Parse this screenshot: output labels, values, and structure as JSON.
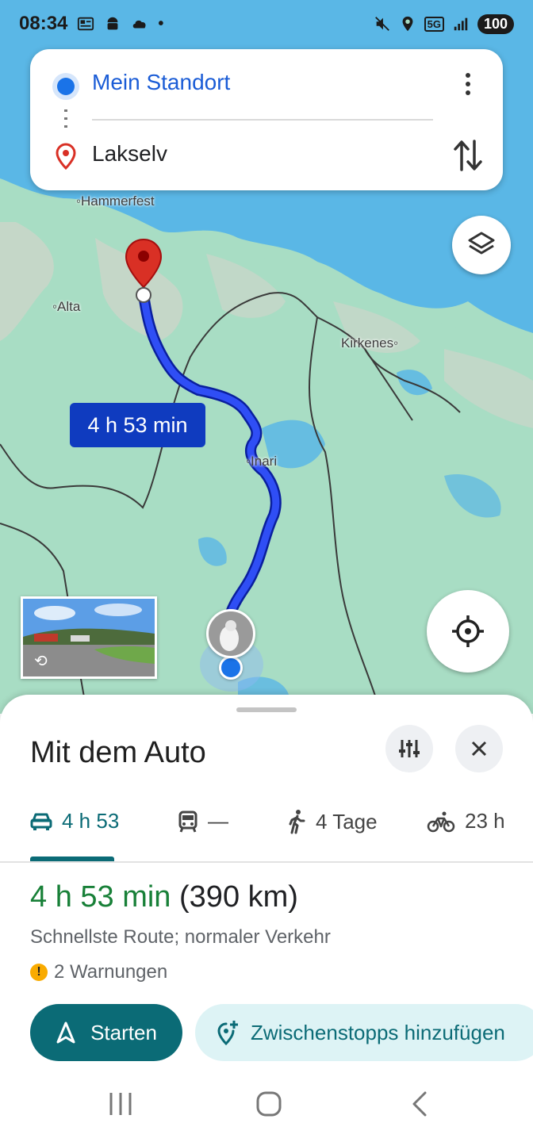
{
  "status_bar": {
    "time": "08:34",
    "battery": "100",
    "icons": [
      "news-icon",
      "android-icon",
      "cloud-icon",
      "dot-icon",
      "mute-icon",
      "location-icon",
      "5g-icon",
      "signal-icon"
    ]
  },
  "search": {
    "origin": "Mein Standort",
    "destination": "Lakselv"
  },
  "map": {
    "labels": {
      "hammerfest": "Hammerfest",
      "alta": "Alta",
      "kirkenes": "Kirkenes",
      "inari": "Inari"
    },
    "route_time_bubble": "4 h 53 min",
    "colors": {
      "route": "#1a2fd6",
      "land": "#a8ddc4",
      "water": "#5ab7e6",
      "destination_pin": "#d93025"
    }
  },
  "sheet": {
    "title": "Mit dem Auto",
    "modes": [
      {
        "icon": "car-icon",
        "label": "4 h 53",
        "active": true
      },
      {
        "icon": "train-icon",
        "label": "—",
        "active": false
      },
      {
        "icon": "walk-icon",
        "label": "4 Tage",
        "active": false
      },
      {
        "icon": "bike-icon",
        "label": "23 h",
        "active": false
      }
    ],
    "route": {
      "duration": "4 h 53 min",
      "distance": "(390 km)",
      "description": "Schnellste Route; normaler Verkehr",
      "warnings": "2 Warnungen"
    },
    "start_label": "Starten",
    "add_stops_label": "Zwischenstopps hinzufügen",
    "accent_color": "#0b6b76"
  }
}
